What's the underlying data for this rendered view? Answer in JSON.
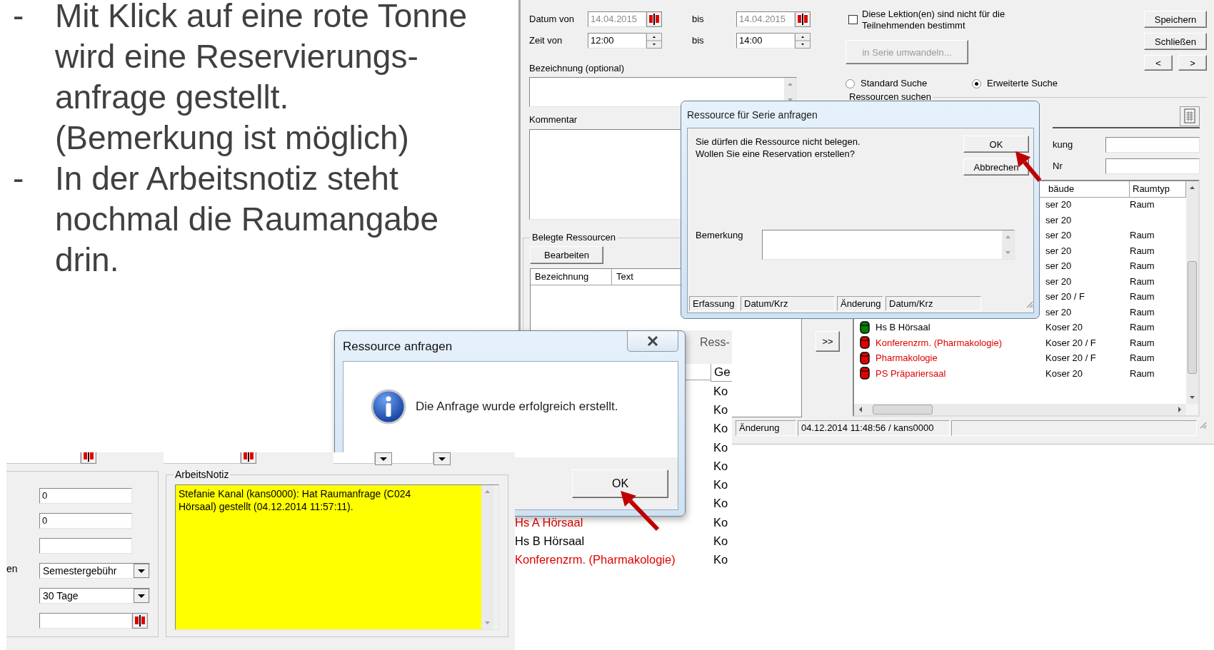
{
  "slide_bullets": [
    {
      "marker": "-",
      "lines": [
        "Mit Klick auf eine rote Tonne",
        "wird eine Reservierungs-",
        "anfrage gestellt.",
        "(Bemerkung ist möglich)"
      ]
    },
    {
      "marker": "-",
      "lines": [
        "In der Arbeitsnotiz steht",
        "nochmal die Raumangabe",
        "drin."
      ]
    }
  ],
  "main_window": {
    "date_row": {
      "label": "Datum von",
      "from": "14.04.2015",
      "to_label": "bis",
      "to": "14.04.2015",
      "disabled": true
    },
    "time_row": {
      "label": "Zeit von",
      "from": "12:00",
      "to_label": "bis",
      "to": "14:00",
      "disabled": false
    },
    "designation_label": "Bezeichnung (optional)",
    "comment_label": "Kommentar",
    "occupied_resources": {
      "title": "Belegte Ressourcen",
      "edit_button": "Bearbeiten",
      "columns": [
        "Bezeichnung",
        "Text"
      ]
    },
    "participants_option": {
      "lines": [
        "Diese Lektion(en) sind nicht für die",
        "Teilnehmenden bestimmt"
      ],
      "checked": false
    },
    "convert_button": {
      "label": "in Serie umwandeln...",
      "disabled": true
    },
    "actions": [
      "Speichern",
      "Schließen"
    ],
    "nav_buttons": [
      "<",
      ">"
    ],
    "search_modes": [
      {
        "label": "Standard Suche",
        "selected": false
      },
      {
        "label": "Erweiterte Suche",
        "selected": true
      }
    ],
    "resource_search": {
      "title": "Ressourcen suchen",
      "fields": [
        {
          "label": "kung"
        },
        {
          "label": "Nr"
        }
      ],
      "columns": [
        "bäude",
        "Raumtyp"
      ],
      "rows": [
        {
          "building": "ser 20",
          "type": "Raum"
        },
        {
          "building": "ser 20"
        },
        {
          "building": "ser 20",
          "type": "Raum"
        },
        {
          "building": "ser 20",
          "type": "Raum"
        },
        {
          "building": "ser 20",
          "type": "Raum"
        },
        {
          "building": "ser 20",
          "type": "Raum"
        },
        {
          "building": "ser 20 / F",
          "type": "Raum"
        },
        {
          "building": "ser 20",
          "type": "Raum"
        },
        {
          "name": "Hs B Hörsaal",
          "occupied": false,
          "building": "Koser 20",
          "type": "Raum"
        },
        {
          "name": "Konferenzrm. (Pharmakologie)",
          "occupied": true,
          "building": "Koser 20 / F",
          "type": "Raum"
        },
        {
          "name": "Pharmakologie",
          "occupied": true,
          "building": "Koser 20 / F",
          "type": "Raum"
        },
        {
          "name": "PS Präpariersaal",
          "occupied": true,
          "building": "Koser 20",
          "type": "Raum"
        }
      ]
    },
    "move_button": ">>",
    "status_bar": {
      "label": "Änderung",
      "value": "04.12.2014 11:48:56 / kans0000"
    }
  },
  "list_fragment": {
    "tab": "Ress-",
    "column": "Ge",
    "rows": [
      {
        "building": "Ko"
      },
      {
        "building": "Ko"
      },
      {
        "building": "Ko"
      },
      {
        "building": "Ko"
      },
      {
        "building": "Ko"
      },
      {
        "building": "Ko"
      },
      {
        "building": "Ko"
      },
      {
        "name": "Hs A Hörsaal",
        "occupied": true,
        "building": "Ko"
      },
      {
        "name": "Hs B Hörsaal",
        "occupied": false,
        "building": "Ko"
      },
      {
        "name": "Konferenzrm. (Pharmakologie)",
        "occupied": true,
        "building": "Ko"
      }
    ]
  },
  "series_dialog": {
    "title": "Ressource für Serie anfragen",
    "message_lines": [
      "Sie dürfen die Ressource nicht belegen.",
      "Wollen Sie eine Reservation erstellen?"
    ],
    "buttons": [
      "OK",
      "Abbrechen"
    ],
    "remark_label": "Bemerkung",
    "status": [
      "Erfassung",
      "Datum/Krz",
      "Änderung",
      "Datum/Krz"
    ]
  },
  "confirm_dialog": {
    "title": "Ressource anfragen",
    "message": "Die Anfrage wurde erfolgreich erstellt.",
    "button": "OK"
  },
  "details_fragment": {
    "fields": [
      {
        "kind": "text",
        "value": "0"
      },
      {
        "kind": "text",
        "value": "0"
      },
      {
        "kind": "text"
      },
      {
        "kind": "select",
        "label": "en",
        "value": "Semestergebühr"
      },
      {
        "kind": "select",
        "value": "30 Tage"
      },
      {
        "kind": "date"
      }
    ],
    "note": {
      "title": "ArbeitsNotiz",
      "lines": [
        "Stefanie Kanal (kans0000): Hat Raumanfrage (C024",
        "Hörsaal) gestellt (04.12.2014 11:57:11)."
      ]
    }
  }
}
